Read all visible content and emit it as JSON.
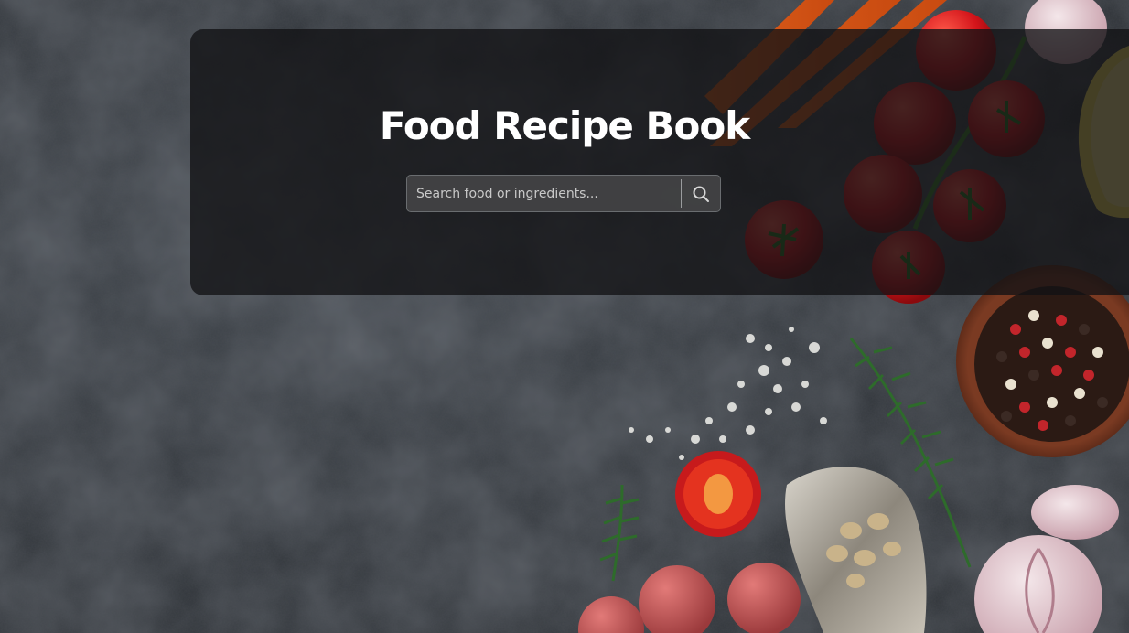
{
  "header": {
    "title": "Food Recipe Book"
  },
  "search": {
    "placeholder": "Search food or ingredients...",
    "value": "",
    "button_icon": "search-icon"
  },
  "colors": {
    "panel": "#121214",
    "title": "#ffffff",
    "background": "#2f3439"
  }
}
